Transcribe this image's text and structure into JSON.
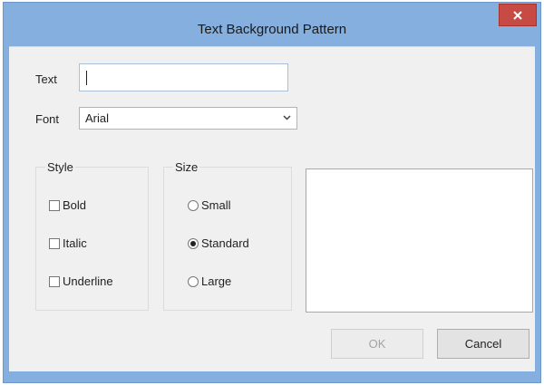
{
  "dialog": {
    "title": "Text Background Pattern",
    "close_icon": "close-icon"
  },
  "text_field": {
    "label": "Text",
    "value": ""
  },
  "font_field": {
    "label": "Font",
    "selected": "Arial",
    "arrow_icon": "chevron-down-icon"
  },
  "style_group": {
    "legend": "Style",
    "options": [
      {
        "label": "Bold",
        "checked": false
      },
      {
        "label": "Italic",
        "checked": false
      },
      {
        "label": "Underline",
        "checked": false
      }
    ]
  },
  "size_group": {
    "legend": "Size",
    "options": [
      {
        "label": "Small",
        "checked": false
      },
      {
        "label": "Standard",
        "checked": true
      },
      {
        "label": "Large",
        "checked": false
      }
    ]
  },
  "buttons": {
    "ok": {
      "label": "OK",
      "enabled": false
    },
    "cancel": {
      "label": "Cancel",
      "enabled": true
    }
  },
  "colors": {
    "title_bar": "#84afde",
    "close_button": "#c74a45",
    "client_bg": "#f0f0f0"
  }
}
